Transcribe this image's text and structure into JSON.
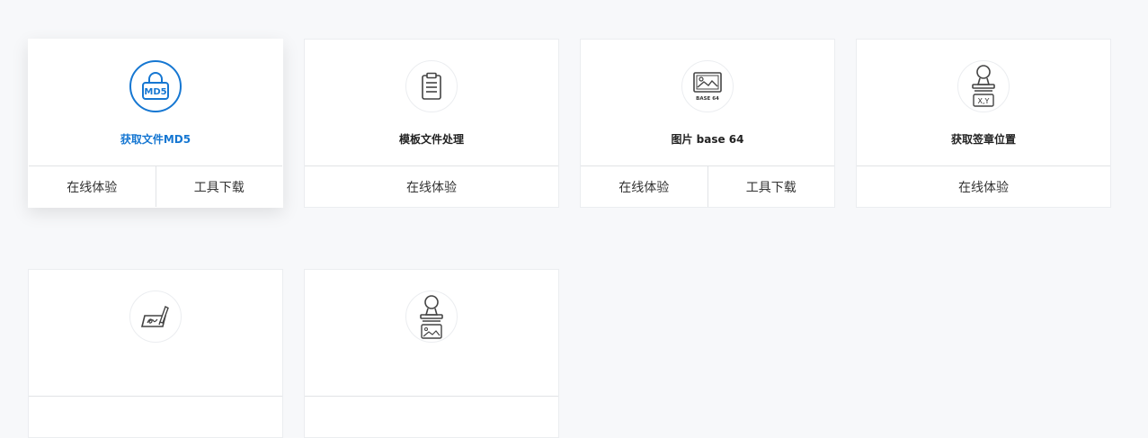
{
  "accent_color": "#1677d2",
  "cards": [
    {
      "title": "获取文件MD5",
      "icon": "md5-lock-icon",
      "icon_text": "MD5",
      "actions": [
        "在线体验",
        "工具下载"
      ]
    },
    {
      "title": "模板文件处理",
      "icon": "clipboard-icon",
      "actions": [
        "在线体验"
      ]
    },
    {
      "title": "图片 base 64",
      "icon": "image-base64-icon",
      "icon_text": "BASE 64",
      "actions": [
        "在线体验",
        "工具下载"
      ]
    },
    {
      "title": "获取签章位置",
      "icon": "stamp-coordinates-icon",
      "icon_text": "X,Y",
      "actions": [
        "在线体验"
      ]
    },
    {
      "title": "",
      "icon": "signature-pen-icon",
      "actions": []
    },
    {
      "title": "",
      "icon": "stamp-image-icon",
      "actions": []
    }
  ]
}
